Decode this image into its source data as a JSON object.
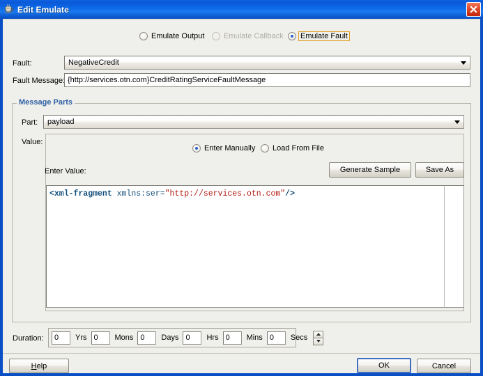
{
  "window": {
    "title": "Edit Emulate",
    "icon": "coffee-cup-icon",
    "close_label": "✕",
    "titlebar_color": "#0d6ae8",
    "close_color": "#c3260b",
    "background": "#efefeb"
  },
  "mode": {
    "options": [
      {
        "label": "Emulate Output",
        "selected": false,
        "disabled": false,
        "focused": false
      },
      {
        "label": "Emulate Callback",
        "selected": false,
        "disabled": true,
        "focused": false
      },
      {
        "label": "Emulate Fault",
        "selected": true,
        "disabled": false,
        "focused": true
      }
    ],
    "focus_color": "#e39b20"
  },
  "fault": {
    "label": "Fault:",
    "value": "NegativeCredit",
    "options": [
      "NegativeCredit"
    ]
  },
  "fault_message": {
    "label": "Fault Message:",
    "value": "{http://services.otn.com}CreditRatingServiceFaultMessage"
  },
  "message_parts": {
    "title": "Message Parts",
    "title_color": "#2e5fa3",
    "part": {
      "label": "Part:",
      "value": "payload",
      "options": [
        "payload"
      ]
    },
    "value": {
      "label": "Value:",
      "source_options": [
        {
          "label": "Enter Manually",
          "selected": true
        },
        {
          "label": "Load From File",
          "selected": false
        }
      ],
      "enter_value_label": "Enter Value:",
      "generate_sample_label": "Generate Sample",
      "save_as_label": "Save As",
      "editor": {
        "tokens": [
          {
            "text": "<xml-fragment",
            "type": "tag"
          },
          {
            "text": " xmlns:ser=",
            "type": "attr"
          },
          {
            "text": "\"http://services.otn.com\"",
            "type": "string"
          },
          {
            "text": "/>",
            "type": "tag"
          }
        ],
        "plain_text": "<xml-fragment xmlns:ser=\"http://services.otn.com\"/>",
        "tag_color": "#14507d",
        "string_color": "#b31a12"
      }
    }
  },
  "duration": {
    "label": "Duration:",
    "fields": [
      {
        "value": "0",
        "unit": "Yrs"
      },
      {
        "value": "0",
        "unit": "Mons"
      },
      {
        "value": "0",
        "unit": "Days"
      },
      {
        "value": "0",
        "unit": "Hrs"
      },
      {
        "value": "0",
        "unit": "Mins"
      },
      {
        "value": "0",
        "unit": "Secs"
      }
    ]
  },
  "footer": {
    "help_label": "Help",
    "help_mnemonic": "H",
    "ok_label": "OK",
    "cancel_label": "Cancel",
    "default_button": "OK"
  }
}
